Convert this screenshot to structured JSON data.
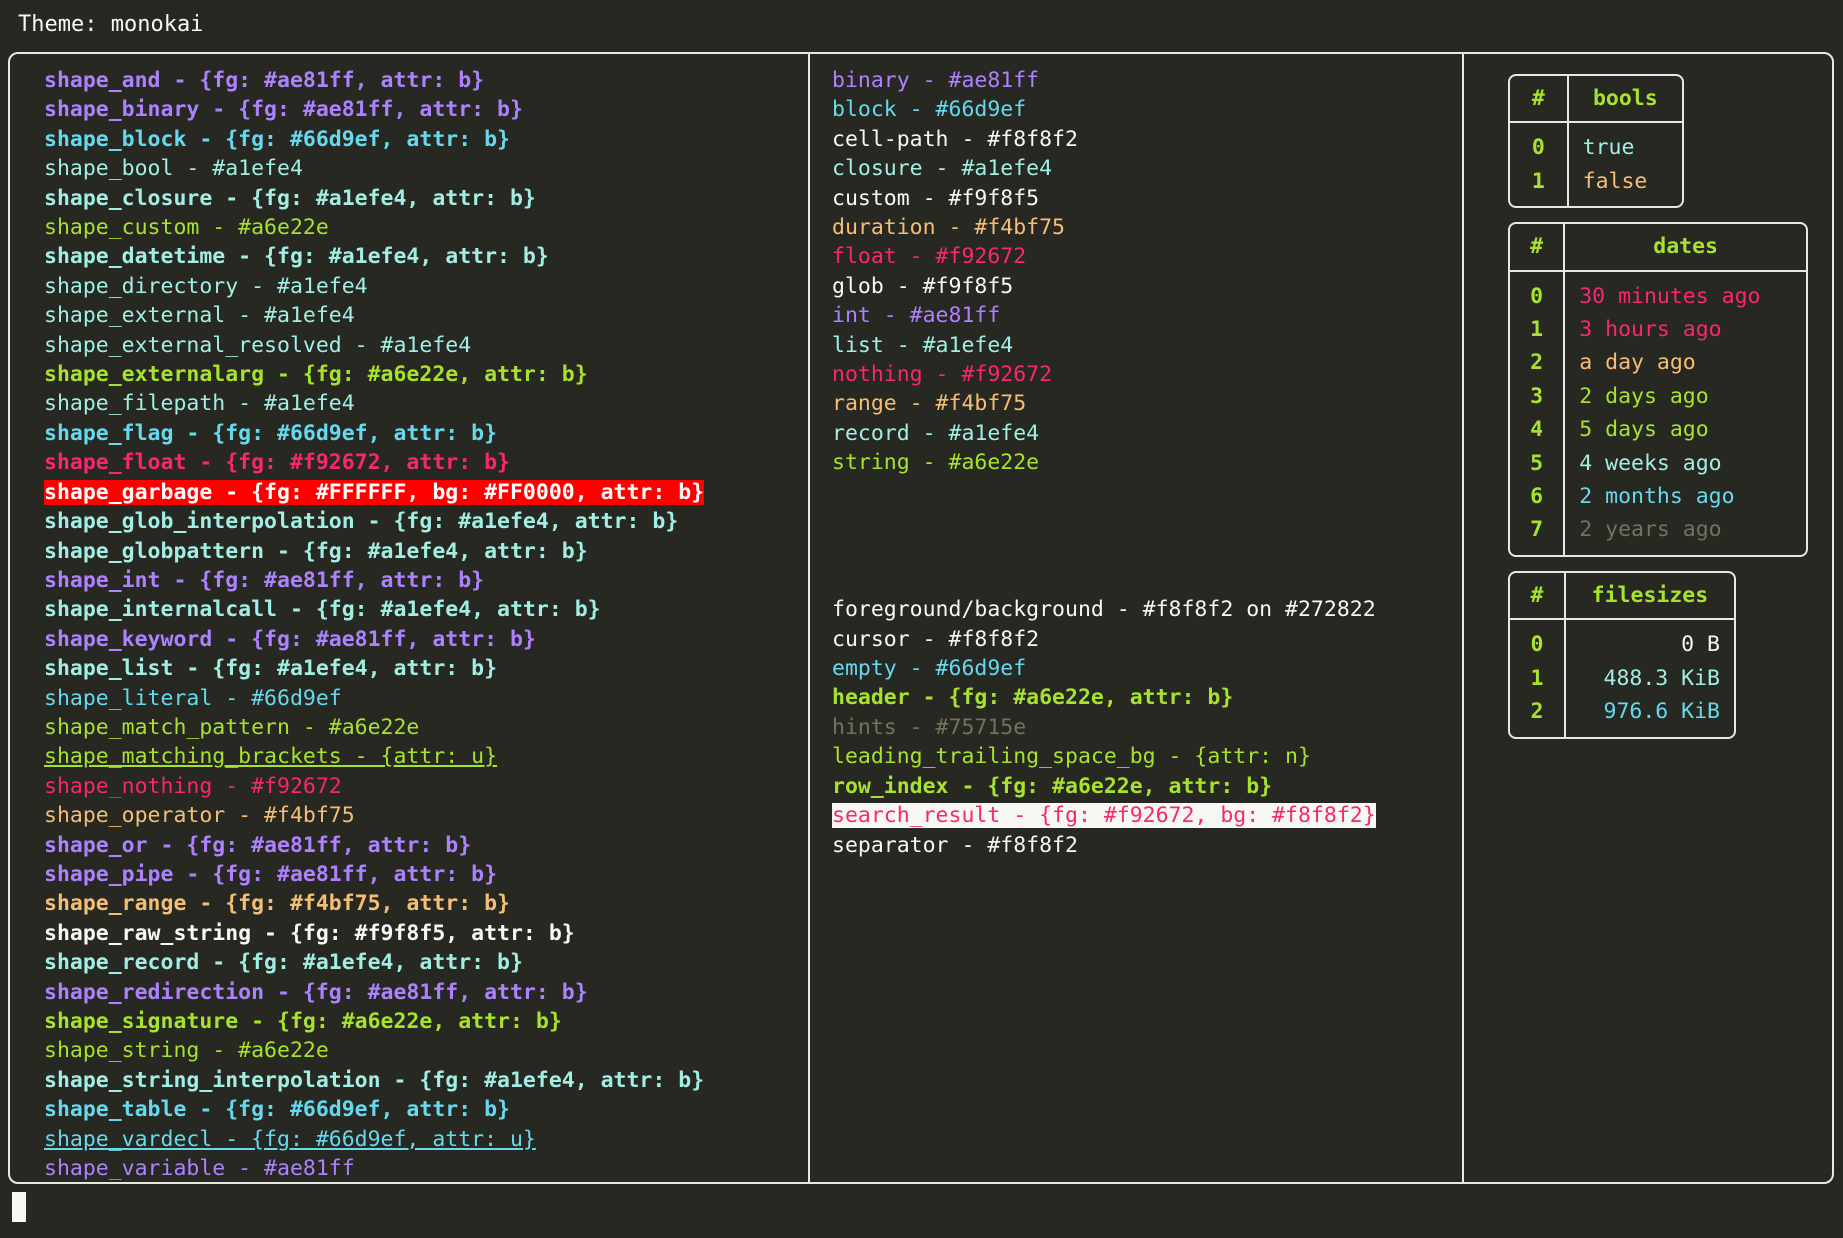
{
  "header": {
    "label": "Theme: monokai"
  },
  "palette": {
    "background": "#272822",
    "foreground": "#f8f8f2",
    "border": "#e8e8e0",
    "purple": "#ae81ff",
    "blue": "#66d9ef",
    "cyan": "#a1efe4",
    "green": "#a6e22e",
    "orange": "#f4bf75",
    "pink": "#f92672",
    "white": "#f9f8f5",
    "gray": "#75715e",
    "garbage_bg": "#FF0000",
    "garbage_fg": "#FFFFFF",
    "search_bg": "#f8f8f2",
    "search_fg": "#f92672"
  },
  "shapes": [
    {
      "text": "shape_and - {fg: #ae81ff, attr: b}"
    },
    {
      "text": "shape_binary - {fg: #ae81ff, attr: b}"
    },
    {
      "text": "shape_block - {fg: #66d9ef, attr: b}"
    },
    {
      "text": "shape_bool - #a1efe4"
    },
    {
      "text": "shape_closure - {fg: #a1efe4, attr: b}"
    },
    {
      "text": "shape_custom - #a6e22e"
    },
    {
      "text": "shape_datetime - {fg: #a1efe4, attr: b}"
    },
    {
      "text": "shape_directory - #a1efe4"
    },
    {
      "text": "shape_external - #a1efe4"
    },
    {
      "text": "shape_external_resolved - #a1efe4"
    },
    {
      "text": "shape_externalarg - {fg: #a6e22e, attr: b}"
    },
    {
      "text": "shape_filepath - #a1efe4"
    },
    {
      "text": "shape_flag - {fg: #66d9ef, attr: b}"
    },
    {
      "text": "shape_float - {fg: #f92672, attr: b}"
    },
    {
      "text": "shape_garbage - {fg: #FFFFFF, bg: #FF0000, attr: b}"
    },
    {
      "text": "shape_glob_interpolation - {fg: #a1efe4, attr: b}"
    },
    {
      "text": "shape_globpattern - {fg: #a1efe4, attr: b}"
    },
    {
      "text": "shape_int - {fg: #ae81ff, attr: b}"
    },
    {
      "text": "shape_internalcall - {fg: #a1efe4, attr: b}"
    },
    {
      "text": "shape_keyword - {fg: #ae81ff, attr: b}"
    },
    {
      "text": "shape_list - {fg: #a1efe4, attr: b}"
    },
    {
      "text": "shape_literal - #66d9ef"
    },
    {
      "text": "shape_match_pattern - #a6e22e"
    },
    {
      "text": "shape_matching_brackets - {attr: u}"
    },
    {
      "text": "shape_nothing - #f92672"
    },
    {
      "text": "shape_operator - #f4bf75"
    },
    {
      "text": "shape_or - {fg: #ae81ff, attr: b}"
    },
    {
      "text": "shape_pipe - {fg: #ae81ff, attr: b}"
    },
    {
      "text": "shape_range - {fg: #f4bf75, attr: b}"
    },
    {
      "text": "shape_raw_string - {fg: #f9f8f5, attr: b}"
    },
    {
      "text": "shape_record - {fg: #a1efe4, attr: b}"
    },
    {
      "text": "shape_redirection - {fg: #ae81ff, attr: b}"
    },
    {
      "text": "shape_signature - {fg: #a6e22e, attr: b}"
    },
    {
      "text": "shape_string - #a6e22e"
    },
    {
      "text": "shape_string_interpolation - {fg: #a1efe4, attr: b}"
    },
    {
      "text": "shape_table - {fg: #66d9ef, attr: b}"
    },
    {
      "text": "shape_vardecl - {fg: #66d9ef, attr: u}"
    },
    {
      "text": "shape_variable - #ae81ff"
    }
  ],
  "types": [
    {
      "text": "binary - #ae81ff"
    },
    {
      "text": "block - #66d9ef"
    },
    {
      "text": "cell-path - #f8f8f2"
    },
    {
      "text": "closure - #a1efe4"
    },
    {
      "text": "custom - #f9f8f5"
    },
    {
      "text": "duration - #f4bf75"
    },
    {
      "text": "float - #f92672"
    },
    {
      "text": "glob - #f9f8f5"
    },
    {
      "text": "int - #ae81ff"
    },
    {
      "text": "list - #a1efe4"
    },
    {
      "text": "nothing - #f92672"
    },
    {
      "text": "range - #f4bf75"
    },
    {
      "text": "record - #a1efe4"
    },
    {
      "text": "string - #a6e22e"
    }
  ],
  "ui_elements": [
    {
      "text": "foreground/background - #f8f8f2 on #272822"
    },
    {
      "text": "cursor - #f8f8f2"
    },
    {
      "text": "empty - #66d9ef"
    },
    {
      "text": "header - {fg: #a6e22e, attr: b}"
    },
    {
      "text": "hints - #75715e"
    },
    {
      "text": "leading_trailing_space_bg - {attr: n}"
    },
    {
      "text": "row_index - {fg: #a6e22e, attr: b}"
    },
    {
      "text": "search_result - {fg: #f92672, bg: #f8f8f2}"
    },
    {
      "text": "separator - #f8f8f2"
    }
  ],
  "tables": {
    "bools": {
      "index_header": "#",
      "value_header": "bools",
      "rows": [
        {
          "index": "0",
          "value": "true"
        },
        {
          "index": "1",
          "value": "false"
        }
      ]
    },
    "dates": {
      "index_header": "#",
      "value_header": "dates",
      "rows": [
        {
          "index": "0",
          "value": "30 minutes ago"
        },
        {
          "index": "1",
          "value": "3 hours ago"
        },
        {
          "index": "2",
          "value": "a day ago"
        },
        {
          "index": "3",
          "value": "2 days ago"
        },
        {
          "index": "4",
          "value": "5 days ago"
        },
        {
          "index": "5",
          "value": "4 weeks ago"
        },
        {
          "index": "6",
          "value": "2 months ago"
        },
        {
          "index": "7",
          "value": "2 years ago"
        }
      ]
    },
    "filesizes": {
      "index_header": "#",
      "value_header": "filesizes",
      "rows": [
        {
          "index": "0",
          "value": "0 B"
        },
        {
          "index": "1",
          "value": "488.3 KiB"
        },
        {
          "index": "2",
          "value": "976.6 KiB"
        }
      ]
    }
  }
}
